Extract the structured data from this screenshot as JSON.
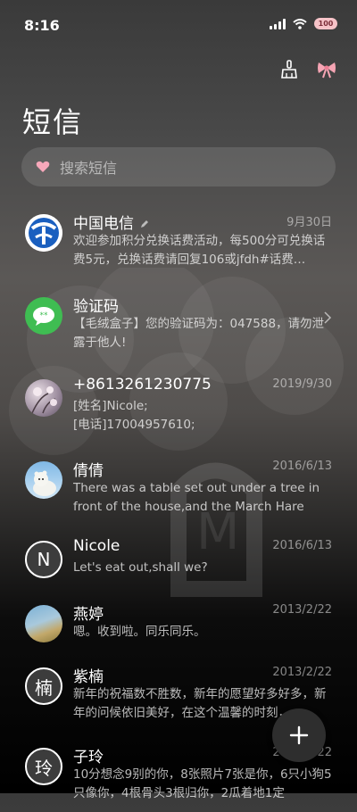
{
  "status_bar": {
    "time": "8:16",
    "battery": "100"
  },
  "toolbar": {
    "clean_icon": "broom-icon",
    "theme_icon": "bow-icon"
  },
  "title": "短信",
  "search": {
    "placeholder": "搜索短信",
    "icon": "heart-icon"
  },
  "conversations": [
    {
      "name": "中国电信",
      "date": "9月30日",
      "preview": "欢迎参加积分兑换话费活动，每500分可兑换话费5元，兑换话费请回复106或jfdh#话费…",
      "avatar": "telecom-logo"
    },
    {
      "name": "验证码",
      "date": "",
      "preview": "【毛绒盒子】您的验证码为：047588，请勿泄露于他人!",
      "avatar": "sms-bubble"
    },
    {
      "name": "+8613261230775",
      "date": "2019/9/30",
      "preview": "[姓名]Nicole;\n[电话]17004957610;",
      "avatar": "photo-blossom"
    },
    {
      "name": "倩倩",
      "date": "2016/6/13",
      "preview": "There was a table set out under a tree in front of the house,and the March Hare an…",
      "avatar": "photo-polar-bear"
    },
    {
      "name": "Nicole",
      "date": "2016/6/13",
      "preview": "Let's eat out,shall we?",
      "avatar": "letter",
      "letter": "N"
    },
    {
      "name": "燕婷",
      "date": "2013/2/22",
      "preview": "嗯。收到啦。同乐同乐。",
      "avatar": "photo-landscape"
    },
    {
      "name": "紫楠",
      "date": "2013/2/22",
      "preview": "新年的祝福数不胜数，新年的愿望好多好多，新年的问候依旧美好，在这个温馨的时刻，…",
      "avatar": "letter",
      "letter": "楠"
    },
    {
      "name": "子玲",
      "date": "2013/2/22",
      "preview": "10分想念9别的你，8张照片7张是你，6只小狗5只像你，4根骨头3根归你，2瓜着地1定",
      "avatar": "letter",
      "letter": "玲"
    }
  ],
  "fab": {
    "label": "+"
  }
}
